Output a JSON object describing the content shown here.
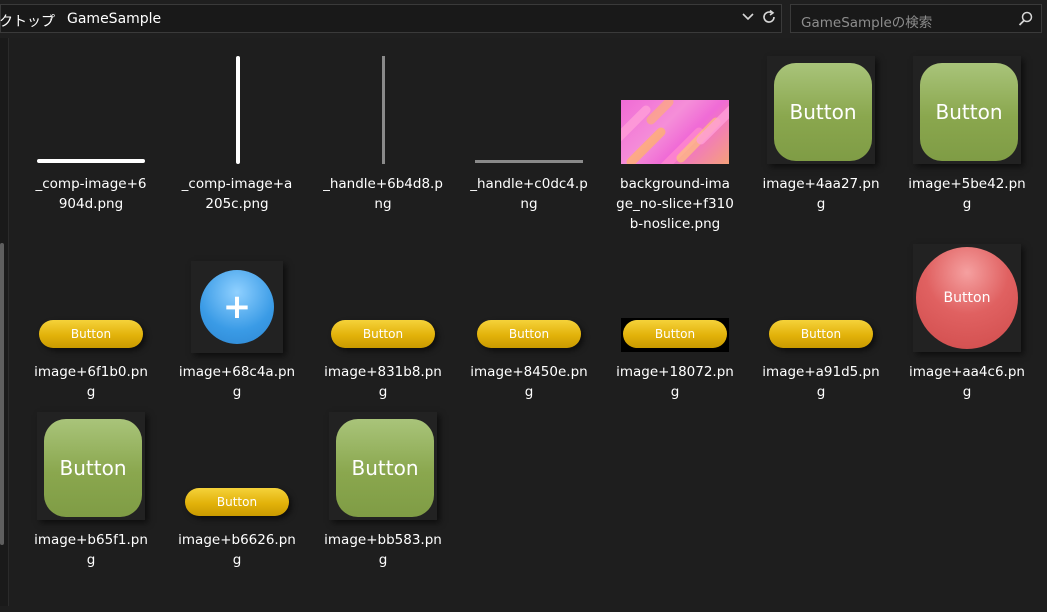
{
  "address_bar": {
    "crumbs": [
      "クトップ",
      "GameSample"
    ],
    "chevron_icon": "chevron-down-icon",
    "refresh_icon": "refresh-icon"
  },
  "search": {
    "placeholder": "GameSampleの検索",
    "icon": "search-icon"
  },
  "files": [
    {
      "name": "_comp-image+6904d.png",
      "label_lines": [
        "_comp-image+6",
        "904d.png"
      ],
      "kind": "hbar-white"
    },
    {
      "name": "_comp-image+a205c.png",
      "label_lines": [
        "_comp-image+a",
        "205c.png"
      ],
      "kind": "vbar-white"
    },
    {
      "name": "_handle+6b4d8.png",
      "label_lines": [
        "_handle+6b4d8.p",
        "ng"
      ],
      "kind": "vbar-gray"
    },
    {
      "name": "_handle+c0dc4.png",
      "label_lines": [
        "_handle+c0dc4.p",
        "ng"
      ],
      "kind": "hbar-gray"
    },
    {
      "name": "background-image_no-slice+f310b-noslice.png",
      "label_lines": [
        "background-ima",
        "ge_no-slice+f310",
        "b-noslice.png"
      ],
      "kind": "pink-bg"
    },
    {
      "name": "image+4aa27.png",
      "label_lines": [
        "image+4aa27.pn",
        "g"
      ],
      "kind": "green",
      "text": "Button"
    },
    {
      "name": "image+5be42.png",
      "label_lines": [
        "image+5be42.pn",
        "g"
      ],
      "kind": "green",
      "text": "Button"
    },
    {
      "name": "image+6f1b0.png",
      "label_lines": [
        "image+6f1b0.pn",
        "g"
      ],
      "kind": "yellow",
      "text": "Button"
    },
    {
      "name": "image+68c4a.png",
      "label_lines": [
        "image+68c4a.pn",
        "g"
      ],
      "kind": "blue-plus",
      "text": "+"
    },
    {
      "name": "image+831b8.png",
      "label_lines": [
        "image+831b8.pn",
        "g"
      ],
      "kind": "yellow",
      "text": "Button"
    },
    {
      "name": "image+8450e.png",
      "label_lines": [
        "image+8450e.pn",
        "g"
      ],
      "kind": "yellow",
      "text": "Button"
    },
    {
      "name": "image+18072.png",
      "label_lines": [
        "image+18072.pn",
        "g"
      ],
      "kind": "yellow-black",
      "text": "Button"
    },
    {
      "name": "image+a91d5.png",
      "label_lines": [
        "image+a91d5.pn",
        "g"
      ],
      "kind": "yellow",
      "text": "Button"
    },
    {
      "name": "image+aa4c6.png",
      "label_lines": [
        "image+aa4c6.pn",
        "g"
      ],
      "kind": "red",
      "text": "Button"
    },
    {
      "name": "image+b65f1.png",
      "label_lines": [
        "image+b65f1.pn",
        "g"
      ],
      "kind": "green",
      "text": "Button"
    },
    {
      "name": "image+b6626.png",
      "label_lines": [
        "image+b6626.pn",
        "g"
      ],
      "kind": "yellow",
      "text": "Button"
    },
    {
      "name": "image+bb583.png",
      "label_lines": [
        "image+bb583.pn",
        "g"
      ],
      "kind": "green",
      "text": "Button"
    }
  ],
  "colors": {
    "background": "#1e1e1e",
    "green_button": "#8aa74e",
    "yellow_button": "#e2b20a",
    "red_button": "#e06161",
    "blue_button": "#3a9be6"
  }
}
